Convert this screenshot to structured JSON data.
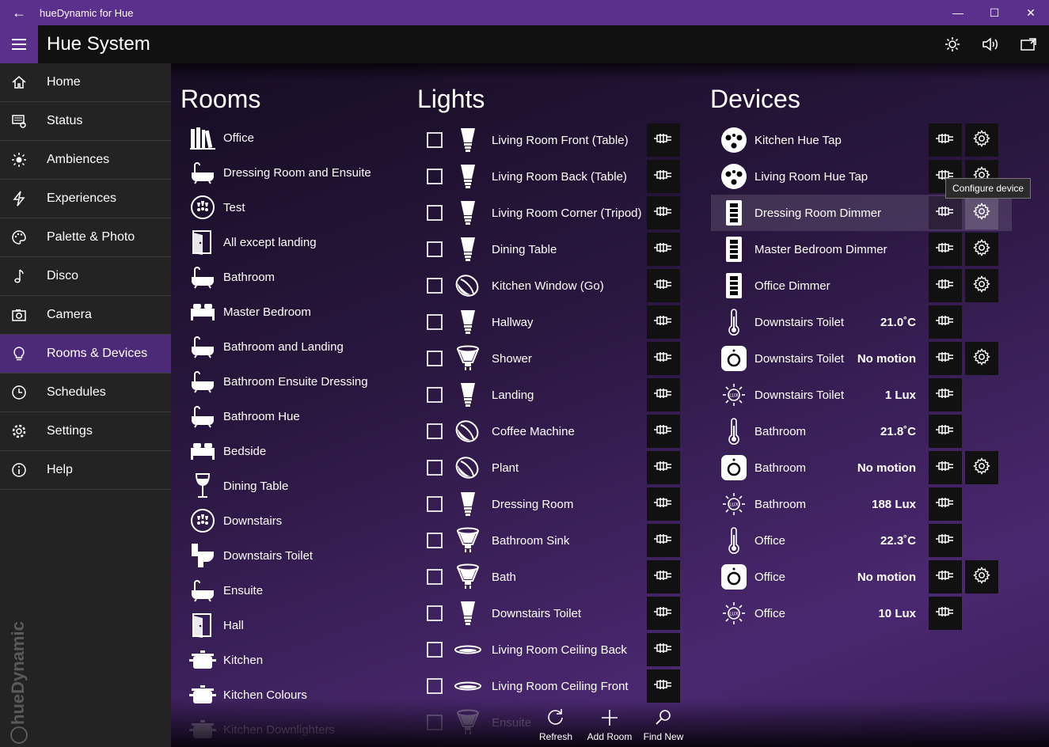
{
  "window": {
    "title": "hueDynamic for Hue"
  },
  "appbar": {
    "title": "Hue System"
  },
  "sidebar": {
    "items": [
      {
        "label": "Home",
        "icon": "home-icon"
      },
      {
        "label": "Status",
        "icon": "status-icon"
      },
      {
        "label": "Ambiences",
        "icon": "sun-icon"
      },
      {
        "label": "Experiences",
        "icon": "lightning-icon"
      },
      {
        "label": "Palette & Photo",
        "icon": "palette-icon"
      },
      {
        "label": "Disco",
        "icon": "music-note-icon"
      },
      {
        "label": "Camera",
        "icon": "camera-icon"
      },
      {
        "label": "Rooms & Devices",
        "icon": "bulb-icon",
        "active": true
      },
      {
        "label": "Schedules",
        "icon": "clock-icon"
      },
      {
        "label": "Settings",
        "icon": "gear-icon"
      },
      {
        "label": "Help",
        "icon": "info-icon"
      }
    ],
    "brand": "hueDynamic"
  },
  "rooms": {
    "title": "Rooms",
    "items": [
      {
        "label": "Office",
        "icon": "books-icon"
      },
      {
        "label": "Dressing Room and Ensuite",
        "icon": "bathtub-icon"
      },
      {
        "label": "Test",
        "icon": "lamps-icon"
      },
      {
        "label": "All except landing",
        "icon": "door-icon"
      },
      {
        "label": "Bathroom",
        "icon": "bathtub-icon"
      },
      {
        "label": "Master Bedroom",
        "icon": "bed-icon"
      },
      {
        "label": "Bathroom and Landing",
        "icon": "bathtub-icon"
      },
      {
        "label": "Bathroom Ensuite Dressing",
        "icon": "bathtub-icon"
      },
      {
        "label": "Bathroom Hue",
        "icon": "bathtub-icon"
      },
      {
        "label": "Bedside",
        "icon": "bed-icon"
      },
      {
        "label": "Dining Table",
        "icon": "wineglass-icon"
      },
      {
        "label": "Downstairs",
        "icon": "lamps-icon"
      },
      {
        "label": "Downstairs Toilet",
        "icon": "toilet-icon"
      },
      {
        "label": "Ensuite",
        "icon": "bathtub-icon"
      },
      {
        "label": "Hall",
        "icon": "door-icon"
      },
      {
        "label": "Kitchen",
        "icon": "pot-icon"
      },
      {
        "label": "Kitchen Colours",
        "icon": "pot-icon"
      },
      {
        "label": "Kitchen Downlighters",
        "icon": "pot-icon"
      }
    ]
  },
  "lights": {
    "title": "Lights",
    "items": [
      {
        "label": "Living Room Front (Table)",
        "icon": "bulb-a19-icon"
      },
      {
        "label": "Living Room Back (Table)",
        "icon": "bulb-a19-icon"
      },
      {
        "label": "Living Room Corner (Tripod)",
        "icon": "bulb-a19-icon"
      },
      {
        "label": "Dining Table",
        "icon": "bulb-a19-icon"
      },
      {
        "label": "Kitchen Window (Go)",
        "icon": "go-lamp-icon"
      },
      {
        "label": "Hallway",
        "icon": "bulb-a19-icon"
      },
      {
        "label": "Shower",
        "icon": "spot-gu10-icon"
      },
      {
        "label": "Landing",
        "icon": "bulb-a19-icon"
      },
      {
        "label": "Coffee Machine",
        "icon": "go-lamp-icon"
      },
      {
        "label": "Plant",
        "icon": "go-lamp-icon"
      },
      {
        "label": "Dressing Room",
        "icon": "bulb-a19-icon"
      },
      {
        "label": "Bathroom Sink",
        "icon": "spot-gu10-icon"
      },
      {
        "label": "Bath",
        "icon": "spot-gu10-icon"
      },
      {
        "label": "Downstairs Toilet",
        "icon": "bulb-a19-icon"
      },
      {
        "label": "Living Room Ceiling Back",
        "icon": "ceiling-disc-icon"
      },
      {
        "label": "Living Room Ceiling Front",
        "icon": "ceiling-disc-icon"
      },
      {
        "label": "Ensuite",
        "icon": "spot-gu10-icon"
      }
    ]
  },
  "devices": {
    "title": "Devices",
    "items": [
      {
        "label": "Kitchen Hue Tap",
        "value": "",
        "icon": "hue-tap-icon",
        "gear": true
      },
      {
        "label": "Living Room Hue Tap",
        "value": "",
        "icon": "hue-tap-icon",
        "gear": true
      },
      {
        "label": "Dressing Room Dimmer",
        "value": "",
        "icon": "dimmer-switch-icon",
        "gear": true,
        "highlight": true
      },
      {
        "label": "Master Bedroom Dimmer",
        "value": "",
        "icon": "dimmer-switch-icon",
        "gear": true
      },
      {
        "label": "Office Dimmer",
        "value": "",
        "icon": "dimmer-switch-icon",
        "gear": true
      },
      {
        "label": "Downstairs Toilet",
        "value": "21.0˚C",
        "icon": "thermometer-icon",
        "gear": false
      },
      {
        "label": "Downstairs Toilet",
        "value": "No motion",
        "icon": "motion-sensor-icon",
        "gear": true
      },
      {
        "label": "Downstairs Toilet",
        "value": "1 Lux",
        "icon": "lux-sun-icon",
        "gear": false
      },
      {
        "label": "Bathroom",
        "value": "21.8˚C",
        "icon": "thermometer-icon",
        "gear": false
      },
      {
        "label": "Bathroom",
        "value": "No motion",
        "icon": "motion-sensor-icon",
        "gear": true
      },
      {
        "label": "Bathroom",
        "value": "188 Lux",
        "icon": "lux-sun-icon",
        "gear": false
      },
      {
        "label": "Office",
        "value": "22.3˚C",
        "icon": "thermometer-icon",
        "gear": false
      },
      {
        "label": "Office",
        "value": "No motion",
        "icon": "motion-sensor-icon",
        "gear": true
      },
      {
        "label": "Office",
        "value": "10 Lux",
        "icon": "lux-sun-icon",
        "gear": false
      }
    ],
    "tooltip": "Configure device"
  },
  "commands": [
    {
      "label": "Refresh",
      "icon": "refresh-icon"
    },
    {
      "label": "Add Room",
      "icon": "plus-icon"
    },
    {
      "label": "Find New",
      "icon": "search-icon"
    }
  ]
}
